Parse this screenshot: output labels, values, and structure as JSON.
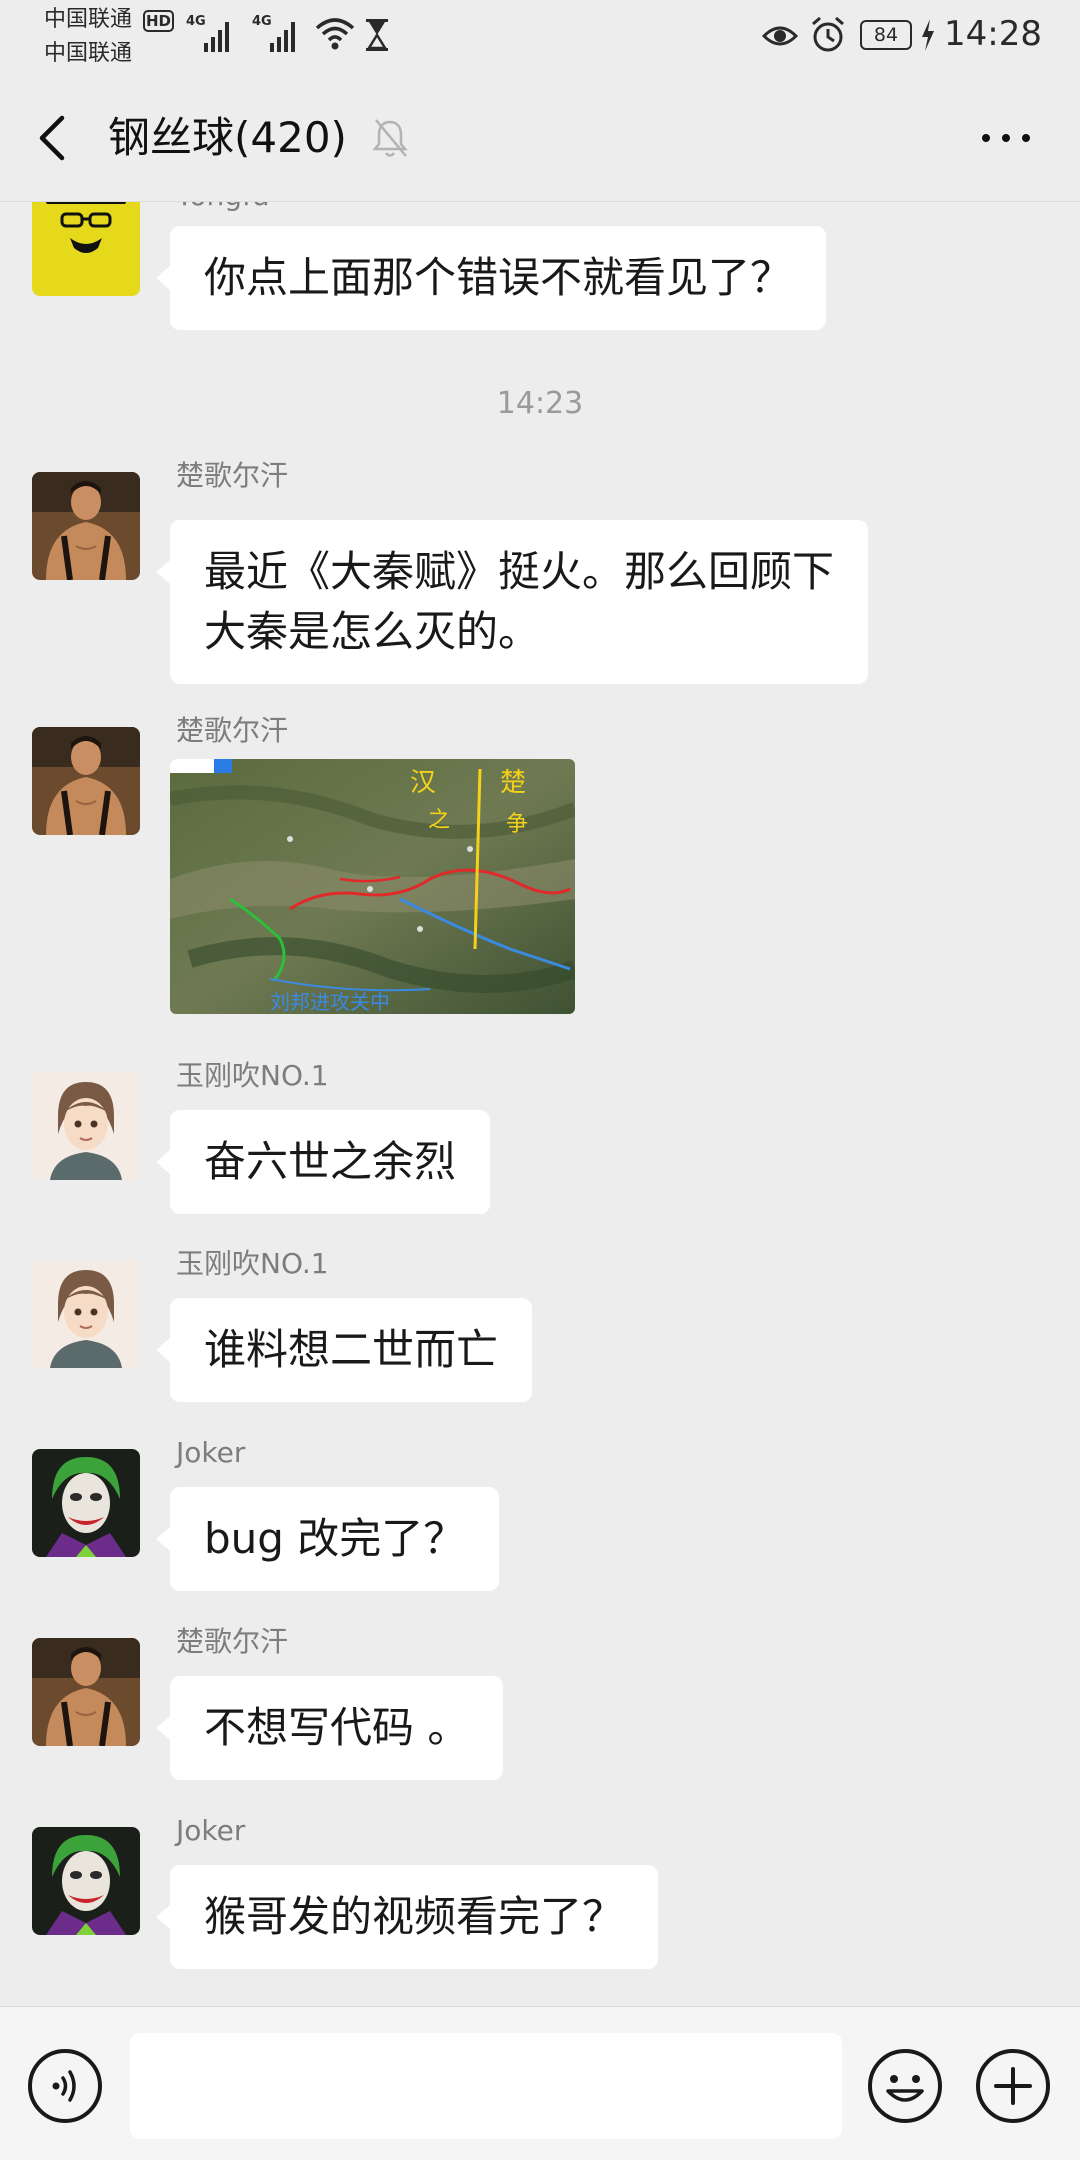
{
  "status_bar": {
    "carrier_1": "中国联通",
    "carrier_2": "中国联通",
    "hd_badge": "HD",
    "network_1": "4G",
    "network_2": "4G",
    "battery_level": "84",
    "time": "14:28",
    "icons": [
      "signal-icon",
      "signal-icon",
      "wifi-icon",
      "hourglass-icon",
      "eye-icon",
      "alarm-icon",
      "battery-icon",
      "charging-bolt-icon"
    ]
  },
  "header": {
    "back_icon": "chevron-left-icon",
    "title": "钢丝球(420)",
    "mute_icon": "bell-off-icon",
    "more_icon": "more-horizontal-icon"
  },
  "messages": [
    {
      "sender": "Yongfu",
      "text": "你点上面那个错误不就看见了？",
      "avatar": "yellow-hat-avatar"
    },
    {
      "timestamp": "14:23"
    },
    {
      "sender": "楚歌尔汗",
      "text": "最近《大秦赋》挺火。那么回顾下\n大秦是怎么灭的。",
      "avatar": "muscle-man-avatar"
    },
    {
      "sender": "楚歌尔汗",
      "image": "annotated-map-image",
      "avatar": "muscle-man-avatar",
      "image_labels": [
        "汉",
        "之",
        "楚",
        "争",
        "刘邦进攻关中"
      ]
    },
    {
      "sender": "玉刚吹NO.1",
      "text": "奋六世之余烈",
      "avatar": "anime-boy-avatar"
    },
    {
      "sender": "玉刚吹NO.1",
      "text": "谁料想二世而亡",
      "avatar": "anime-boy-avatar"
    },
    {
      "sender": "Joker",
      "text": "bug 改完了？",
      "avatar": "joker-avatar"
    },
    {
      "sender": "楚歌尔汗",
      "text": "不想写代码 。",
      "avatar": "muscle-man-avatar"
    },
    {
      "sender": "Joker",
      "text": "猴哥发的视频看完了？",
      "avatar": "joker-avatar"
    }
  ],
  "input_bar": {
    "voice_icon": "voice-icon",
    "input_value": "",
    "emoji_icon": "emoji-icon",
    "plus_icon": "plus-circle-icon"
  },
  "colors": {
    "background": "#ededed",
    "bubble": "#ffffff",
    "sender_text": "#7d7d7d",
    "timestamp_text": "#9a9a9a"
  }
}
